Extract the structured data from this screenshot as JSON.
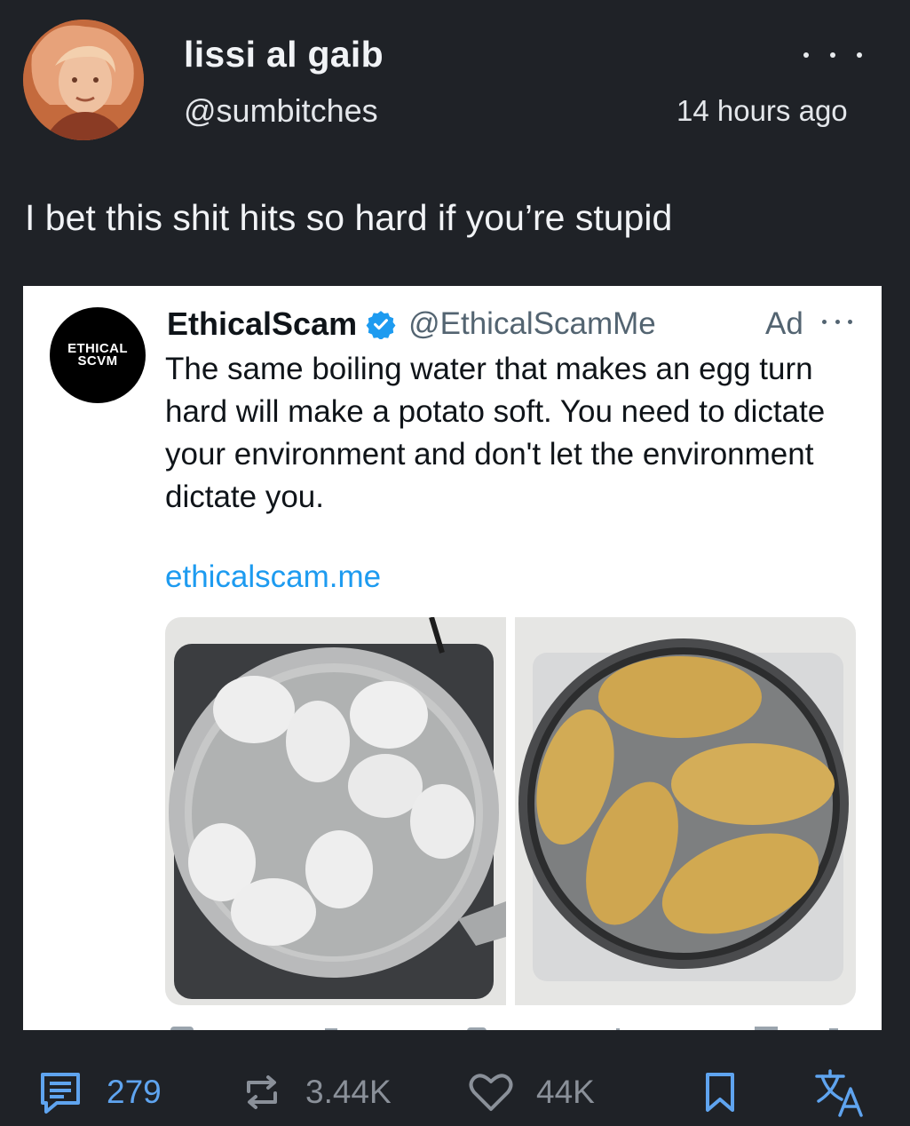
{
  "post": {
    "author_name": "lissi al gaib",
    "author_handle": "@sumbitches",
    "timestamp": "14 hours ago",
    "text": "I bet this shit hits so hard if you’re stupid"
  },
  "embedded_ad": {
    "avatar_text_line1": "ETHICAL",
    "avatar_text_line2": "SCVM",
    "name": "EthicalScam",
    "handle": "@EthicalScamMe",
    "ad_label": "Ad",
    "body": "The same boiling water that makes an egg turn hard will make a potato soft. You need to dictate your environment and don't let the environment dictate you.",
    "link": "ethicalscam.me"
  },
  "actions": {
    "reply_count": "279",
    "repost_count": "3.44K",
    "like_count": "44K"
  },
  "colors": {
    "background": "#1f2227",
    "accent_blue": "#5fa4ef",
    "muted_icon": "#8a9099",
    "link_blue": "#1d9bf0",
    "verified_blue": "#1d9bf0"
  },
  "icons": [
    "avatar",
    "more-icon",
    "verified-badge-icon",
    "reply-icon",
    "repost-icon",
    "like-icon",
    "bookmark-icon",
    "translate-icon"
  ]
}
